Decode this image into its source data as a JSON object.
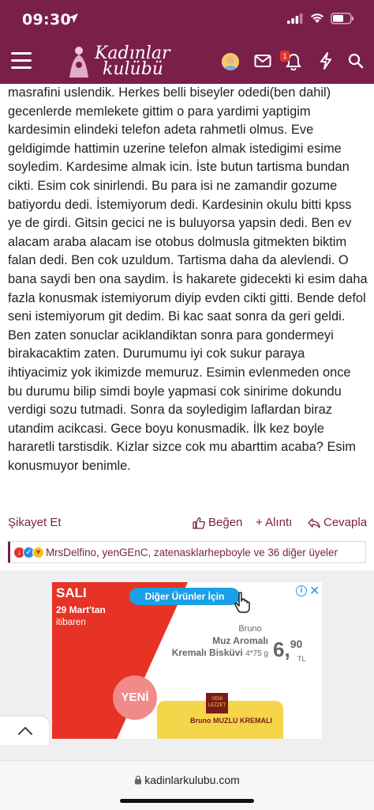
{
  "status_bar": {
    "time": "09:30"
  },
  "header": {
    "logo_line1": "Kadınlar",
    "logo_line2": "kulübü",
    "notification_count": "1",
    "brand_color": "#7a1f4a",
    "icons": [
      "menu-icon",
      "avatar",
      "mail-icon",
      "bell-icon",
      "lightning-icon",
      "search-icon"
    ]
  },
  "post": {
    "body": "masrafini uslendik. Herkes belli biseyler odedi(ben dahil) gecenlerde memlekete gittim o para yardimi yaptigim kardesimin elindeki telefon adeta rahmetli olmus. Eve geldigimde hattimin uzerine telefon almak istedigimi esime soyledim. Kardesime almak icin. İste butun tartisma bundan cikti. Esim cok sinirlendi. Bu para isi ne zamandir gozume batiyordu dedi. İstemiyorum dedi. Kardesinin okulu bitti kpss ye de girdi. Gitsin gecici ne is buluyorsa yapsin dedi. Ben ev alacam araba alacam ise otobus dolmusla gitmekten biktim falan dedi. Ben cok uzuldum. Tartisma daha da alevlendi. O bana saydi ben ona saydim. İs hakarete gidecekti ki esim daha fazla konusmak istemiyorum diyip evden cikti gitti. Bende defol seni istemiyorum git dedim. Bi kac saat sonra da geri geldi. Ben zaten sonuclar aciklandiktan sonra para gondermeyi birakacaktim zaten. Durumumu iyi cok sukur paraya ihtiyacimiz yok ikimizde memuruz. Esimin evlenmeden once bu durumu bilip simdi boyle yapmasi cok sinirime dokundu verdigi sozu tutmadi. Sonra da soyledigim laflardan biraz utandim acikcasi. Gece boyu konusmadik. İlk kez boyle hararetli tarstisdik. Kizlar sizce cok mu abarttim acaba? Esim konusmuyor benimle.",
    "actions": {
      "complain": "Şikayet Et",
      "like": "Beğen",
      "quote": "+ Alıntı",
      "reply": "Cevapla"
    },
    "reactions_text": "MrsDelfino, yenGEnC, zatenasklarhepboyle ve 36 diğer üyeler"
  },
  "ad": {
    "day": "SALI",
    "date": "29 Mart'tan",
    "date_suffix": "itibaren",
    "button": "Diğer Ürünler İçin",
    "brand": "Bruno",
    "product_line1": "Muz Aromalı",
    "product_line2": "Kremalı Bisküvi",
    "product_size": "4*75 g",
    "price_main": "6,",
    "price_cents": "90",
    "currency": "TL",
    "new_label": "YENİ",
    "pack_tag": "YENİ LEZZET",
    "pack_brand": "Bruno MUZLU KREMALI"
  },
  "browser": {
    "url": "kadinlarkulubu.com"
  }
}
